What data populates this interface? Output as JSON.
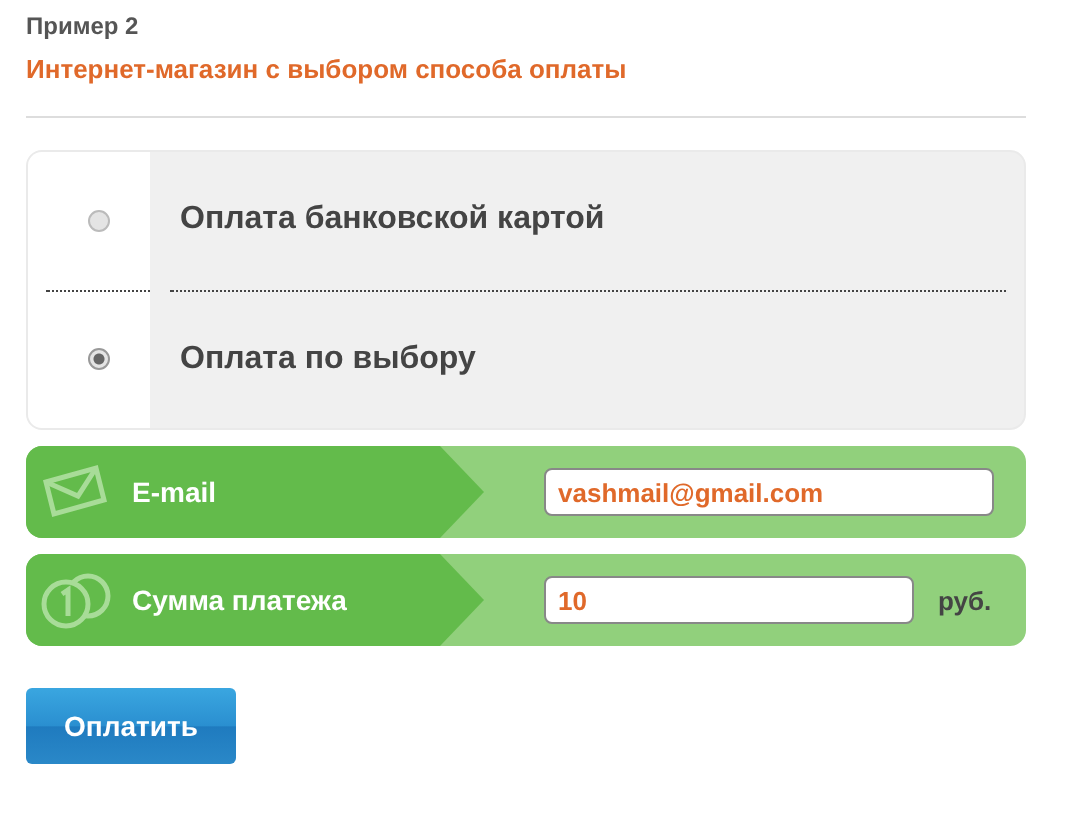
{
  "example_label": "Пример 2",
  "title": "Интернет-магазин с выбором способа оплаты",
  "payment_options": [
    {
      "label": "Оплата банковской картой",
      "selected": false
    },
    {
      "label": "Оплата по выбору",
      "selected": true
    }
  ],
  "fields": [
    {
      "kind": "email",
      "label": "E-mail",
      "value": "vashmail@gmail.com"
    },
    {
      "kind": "amount",
      "label": "Сумма платежа",
      "value": "10",
      "unit": "руб."
    }
  ],
  "submit_button": "Оплатить"
}
